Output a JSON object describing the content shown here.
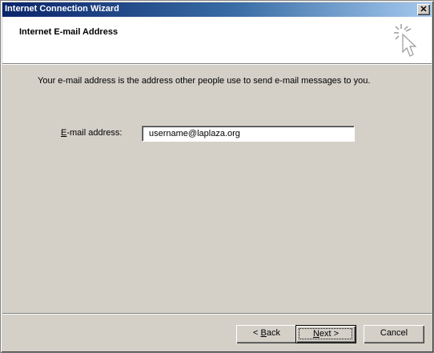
{
  "window": {
    "title": "Internet Connection Wizard",
    "close_glyph": "✕"
  },
  "header": {
    "title": "Internet E-mail Address",
    "icon": "wizard-cursor-icon"
  },
  "main": {
    "description": "Your e-mail address is the address other people use to send e-mail messages to you.",
    "email_label_mnemonic": "E",
    "email_label_rest": "-mail address:",
    "email_value": "username@laplaza.org"
  },
  "buttons": {
    "back_prefix": "< ",
    "back_mnemonic": "B",
    "back_rest": "ack",
    "next_mnemonic": "N",
    "next_rest": "ext >",
    "cancel": "Cancel"
  },
  "colors": {
    "titlebar_start": "#0a246a",
    "titlebar_end": "#a6caf0",
    "face": "#d4d0c8"
  }
}
